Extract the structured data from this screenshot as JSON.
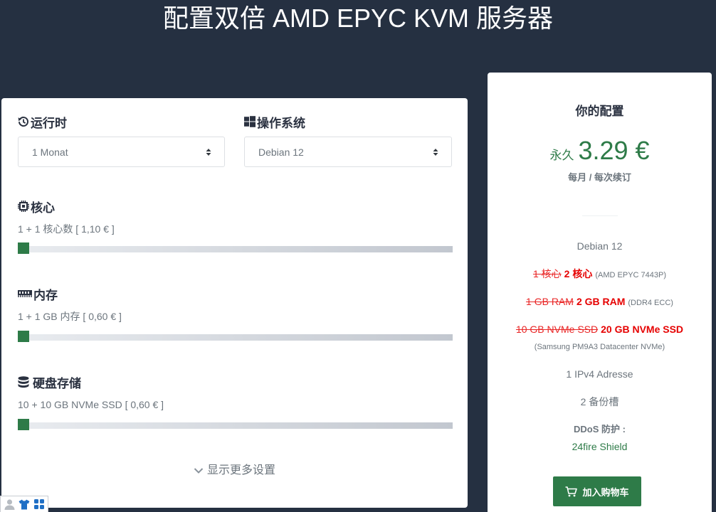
{
  "page": {
    "title": "配置双倍 AMD EPYC KVM 服务器"
  },
  "colors": {
    "background": "#253041",
    "accent_green": "#2e7b48",
    "discount_red": "#e60000",
    "muted_text": "#6c757d",
    "heading_text": "#2a3140"
  },
  "config": {
    "runtime": {
      "label": "运行时",
      "icon": "history-icon",
      "selected": "1 Monat"
    },
    "os": {
      "label": "操作系统",
      "icon": "windows-icon",
      "selected": "Debian 12"
    },
    "cores": {
      "label": "核心",
      "icon": "chip-icon",
      "description": "1 + 1 核心数 [ 1,10 € ]",
      "level": 0
    },
    "memory": {
      "label": "内存",
      "icon": "memory-icon",
      "description": "1 + 1 GB 内存 [ 0,60 € ]",
      "level": 0
    },
    "storage": {
      "label": "硬盘存储",
      "icon": "database-icon",
      "description": "10 + 10 GB NVMe SSD [ 0,60 € ]",
      "level": 0
    },
    "show_more": {
      "label": "显示更多设置",
      "icon": "chevron-down-icon"
    }
  },
  "summary": {
    "title": "你的配置",
    "price_prefix": "永久",
    "price": "3.29 €",
    "billing_note": "每月 / 每次续订",
    "os": "Debian 12",
    "cores": {
      "old": "1 核心",
      "new": "2 核心",
      "note": "(AMD EPYC 7443P)"
    },
    "ram": {
      "old": "1 GB RAM",
      "new": "2 GB RAM",
      "note": "(DDR4 ECC)"
    },
    "storage": {
      "old": "10 GB NVMe SSD",
      "new": "20 GB NVMe SSD",
      "note": "(Samsung PM9A3 Datacenter NVMe)"
    },
    "ipv4": "1 IPv4 Adresse",
    "backups": "2 备份槽",
    "ddos_label": "DDoS 防护 :",
    "ddos_value": "24fire Shield",
    "cart_button": {
      "label": "加入购物车",
      "icon": "cart-icon"
    }
  },
  "floating_toolbar": {
    "icons": [
      "user-icon",
      "tshirt-icon",
      "apps-grid-icon"
    ]
  }
}
